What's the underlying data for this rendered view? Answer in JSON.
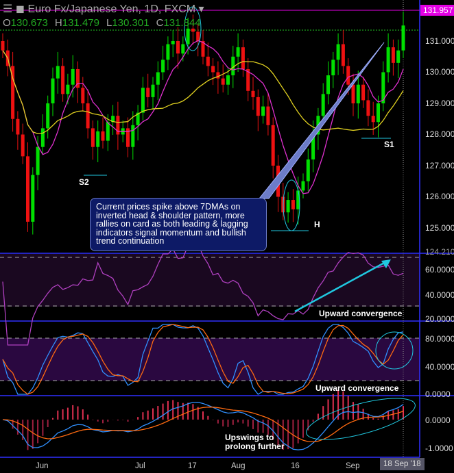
{
  "header": {
    "title": "Euro Fx/Japanese Yen, 1D, FXCM",
    "open": "130.673",
    "high": "131.479",
    "low": "130.301",
    "close": "131.844",
    "o": "O",
    "h": "H",
    "l": "L",
    "c": "C"
  },
  "price_tag": "131.957",
  "date_tag": "18 Sep '18",
  "price_axis": [
    "131.000",
    "130.000",
    "129.000",
    "128.000",
    "127.000",
    "126.000",
    "125.000",
    "124.210"
  ],
  "rsi_axis": [
    "60.0000",
    "40.0000",
    "20.0000"
  ],
  "stoch_axis": [
    "80.0000",
    "40.0000",
    "0.0000"
  ],
  "macd_axis": [
    "0.0000",
    "-1.0000"
  ],
  "date_axis": [
    "Jun",
    "Jul",
    "17",
    "Aug",
    "16",
    "Sep"
  ],
  "annotations": {
    "callout": "Current prices spike above 7DMAs on inverted head & shoulder pattern, more rallies on card as both leading & lagging indicators signal momentum and bullish trend continuation",
    "s2": "S2",
    "s1": "S1",
    "h": "H",
    "rsi_note": "Upward convergence",
    "stoch_note": "Upward convergence",
    "macd_note": "Upswings to prolong further"
  },
  "colors": {
    "up": "#00e000",
    "down": "#ee1111",
    "ma_fast": "#e030d0",
    "ma_slow": "#e0d020",
    "accent": "#20c8e0"
  },
  "chart_data": {
    "type": "candlestick",
    "symbol": "EUR/JPY",
    "ylim": [
      124.21,
      131.957
    ],
    "closes": [
      130.7,
      130.2,
      128.5,
      128.0,
      127.3,
      125.2,
      126.7,
      127.6,
      128.2,
      129.0,
      129.8,
      130.2,
      129.3,
      129.6,
      130.1,
      129.5,
      129.0,
      128.2,
      127.6,
      128.1,
      127.8,
      128.4,
      128.6,
      128.0,
      128.2,
      127.6,
      128.3,
      128.7,
      129.5,
      129.2,
      129.6,
      130.0,
      130.4,
      130.9,
      131.0,
      130.6,
      130.9,
      131.4,
      131.3,
      131.0,
      130.5,
      130.2,
      130.0,
      129.8,
      129.6,
      129.9,
      130.5,
      130.8,
      130.1,
      129.4,
      129.2,
      128.6,
      128.9,
      128.3,
      127.0,
      126.0,
      125.5,
      125.9,
      125.6,
      126.2,
      126.5,
      127.2,
      128.0,
      128.6,
      129.3,
      129.9,
      130.4,
      130.9,
      130.2,
      129.6,
      129.0,
      129.6,
      129.1,
      128.6,
      128.4,
      129.0,
      130.0,
      130.8,
      130.3,
      130.7,
      131.5
    ]
  }
}
